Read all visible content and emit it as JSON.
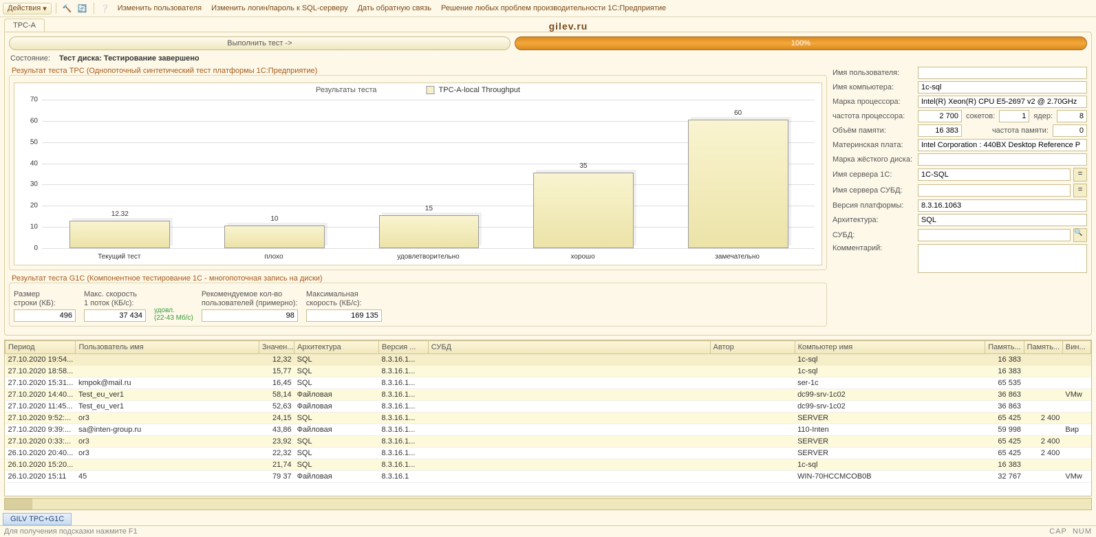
{
  "toolbar": {
    "actions_label": "Действия",
    "link_change_user": "Изменить пользователя",
    "link_change_login": "Изменить логин/пароль к SQL-серверу",
    "link_feedback": "Дать обратную связь",
    "link_solution": "Решение любых проблем производительности 1С:Предприятие"
  },
  "tab": {
    "label": "TPC-A"
  },
  "brand": "gilev.ru",
  "run_button": "Выполнить тест ->",
  "progress_text": "100%",
  "status": {
    "label": "Состояние:",
    "value": "Тест диска: Тестирование завершено"
  },
  "fieldset_tpc_title": "Результат теста TPC (Однопоточный синтетический тест платформы 1С:Предприятие)",
  "chart_legend_title": "Результаты теста",
  "chart_legend_series": "TPC-A-local Throughput",
  "chart_data": {
    "type": "bar",
    "title": "Результаты теста",
    "series_name": "TPC-A-local Throughput",
    "categories": [
      "Текущий тест",
      "плохо",
      "удовлетворительно",
      "хорошо",
      "замечательно"
    ],
    "values": [
      12.32,
      10,
      15,
      35,
      60
    ],
    "ylim": [
      0,
      70
    ],
    "yticks": [
      0,
      10,
      20,
      30,
      40,
      50,
      60,
      70
    ],
    "xlabel": "",
    "ylabel": ""
  },
  "fieldset_g1c_title": "Результат теста G1C (Компонентное тестирование 1С - многопоточная запись на диски)",
  "g1c": {
    "row_size_label": "Размер\nстроки (КБ):",
    "row_size": "496",
    "max_speed_label": "Макс. скорость\n1 поток (КБ/с):",
    "max_speed": "37 434",
    "note": "удовл.\n(22-43 Мб/с)",
    "rec_users_label": "Рекомендуемое кол-во\nпользователей (примерно):",
    "rec_users": "98",
    "max_speed2_label": "Максимальная\nскорость (КБ/с):",
    "max_speed2": "169 135"
  },
  "form": {
    "user_label": "Имя пользователя:",
    "user": "",
    "computer_label": "Имя компьютера:",
    "computer": "1c-sql",
    "cpu_brand_label": "Марка процессора:",
    "cpu_brand": "Intel(R) Xeon(R) CPU E5-2697 v2 @ 2.70GHz",
    "cpu_freq_label": "частота процессора:",
    "cpu_freq": "2 700",
    "sockets_label": "сокетов:",
    "sockets": "1",
    "cores_label": "ядер:",
    "cores": "8",
    "ram_label": "Объём памяти:",
    "ram": "16 383",
    "ram_freq_label": "частота памяти:",
    "ram_freq": "0",
    "mobo_label": "Материнская плата:",
    "mobo": "Intel Corporation : 440BX Desktop Reference P",
    "hdd_label": "Марка жёсткого диска:",
    "hdd": "",
    "srv1c_label": "Имя сервера 1С:",
    "srv1c": "1C-SQL",
    "srvdb_label": "Имя сервера СУБД:",
    "srvdb": "",
    "platver_label": "Версия платформы:",
    "platver": "8.3.16.1063",
    "arch_label": "Архитектура:",
    "arch": "SQL",
    "dbms_label": "СУБД:",
    "dbms": "",
    "comment_label": "Комментарий:"
  },
  "table": {
    "headers": [
      "Период",
      "Пользователь имя",
      "Значен...",
      "Архитектура",
      "Версия ...",
      "СУБД",
      "Автор",
      "Компьютер имя",
      "Память...",
      "Память...",
      "Вин..."
    ],
    "rows": [
      {
        "hl": "sel",
        "c": [
          "27.10.2020 19:54...",
          "",
          "12,32",
          "SQL",
          "8.3.16.1...",
          "",
          "",
          "1c-sql",
          "16 383",
          "",
          ""
        ]
      },
      {
        "hl": "hilite",
        "c": [
          "27.10.2020 18:58...",
          "",
          "15,77",
          "SQL",
          "8.3.16.1...",
          "",
          "",
          "1c-sql",
          "16 383",
          "",
          ""
        ]
      },
      {
        "hl": "",
        "c": [
          "27.10.2020 15:31...",
          "kmpok@mail.ru",
          "16,45",
          "SQL",
          "8.3.16.1...",
          "",
          "",
          "ser-1c",
          "65 535",
          "",
          ""
        ]
      },
      {
        "hl": "hilite",
        "c": [
          "27.10.2020 14:40...",
          "Test_eu_ver1",
          "58,14",
          "Файловая",
          "8.3.16.1...",
          "",
          "",
          "dc99-srv-1c02",
          "36 863",
          "",
          "VMw"
        ]
      },
      {
        "hl": "",
        "c": [
          "27.10.2020 11:45...",
          "Test_eu_ver1",
          "52,63",
          "Файловая",
          "8.3.16.1...",
          "",
          "",
          "dc99-srv-1c02",
          "36 863",
          "",
          ""
        ]
      },
      {
        "hl": "hilite",
        "c": [
          "27.10.2020 9:52:...",
          "or3",
          "24,15",
          "SQL",
          "8.3.16.1...",
          "",
          "",
          "SERVER",
          "65 425",
          "2 400",
          ""
        ]
      },
      {
        "hl": "",
        "c": [
          "27.10.2020 9:39:...",
          "sa@inten-group.ru",
          "43,86",
          "Файловая",
          "8.3.16.1...",
          "",
          "",
          "110-Inten",
          "59 998",
          "",
          "Вир"
        ]
      },
      {
        "hl": "hilite",
        "c": [
          "27.10.2020 0:33:...",
          "or3",
          "23,92",
          "SQL",
          "8.3.16.1...",
          "",
          "",
          "SERVER",
          "65 425",
          "2 400",
          ""
        ]
      },
      {
        "hl": "",
        "c": [
          "26.10.2020 20:40...",
          "or3",
          "22,32",
          "SQL",
          "8.3.16.1...",
          "",
          "",
          "SERVER",
          "65 425",
          "2 400",
          ""
        ]
      },
      {
        "hl": "hilite",
        "c": [
          "26.10.2020 15:20...",
          "",
          "21,74",
          "SQL",
          "8.3.16.1...",
          "",
          "",
          "1c-sql",
          "16 383",
          "",
          ""
        ]
      },
      {
        "hl": "",
        "c": [
          "26.10.2020 15:11",
          "45",
          "79 37",
          "Файловая",
          "8.3.16.1",
          "",
          "",
          "WIN-70HCCMCOB0B",
          "32 767",
          "",
          "VMw"
        ]
      }
    ]
  },
  "bottom_tab": "GILV TPC+G1C",
  "statusbar": {
    "hint": "Для получения подсказки нажмите F1",
    "caps": "CAP",
    "num": "NUM"
  }
}
